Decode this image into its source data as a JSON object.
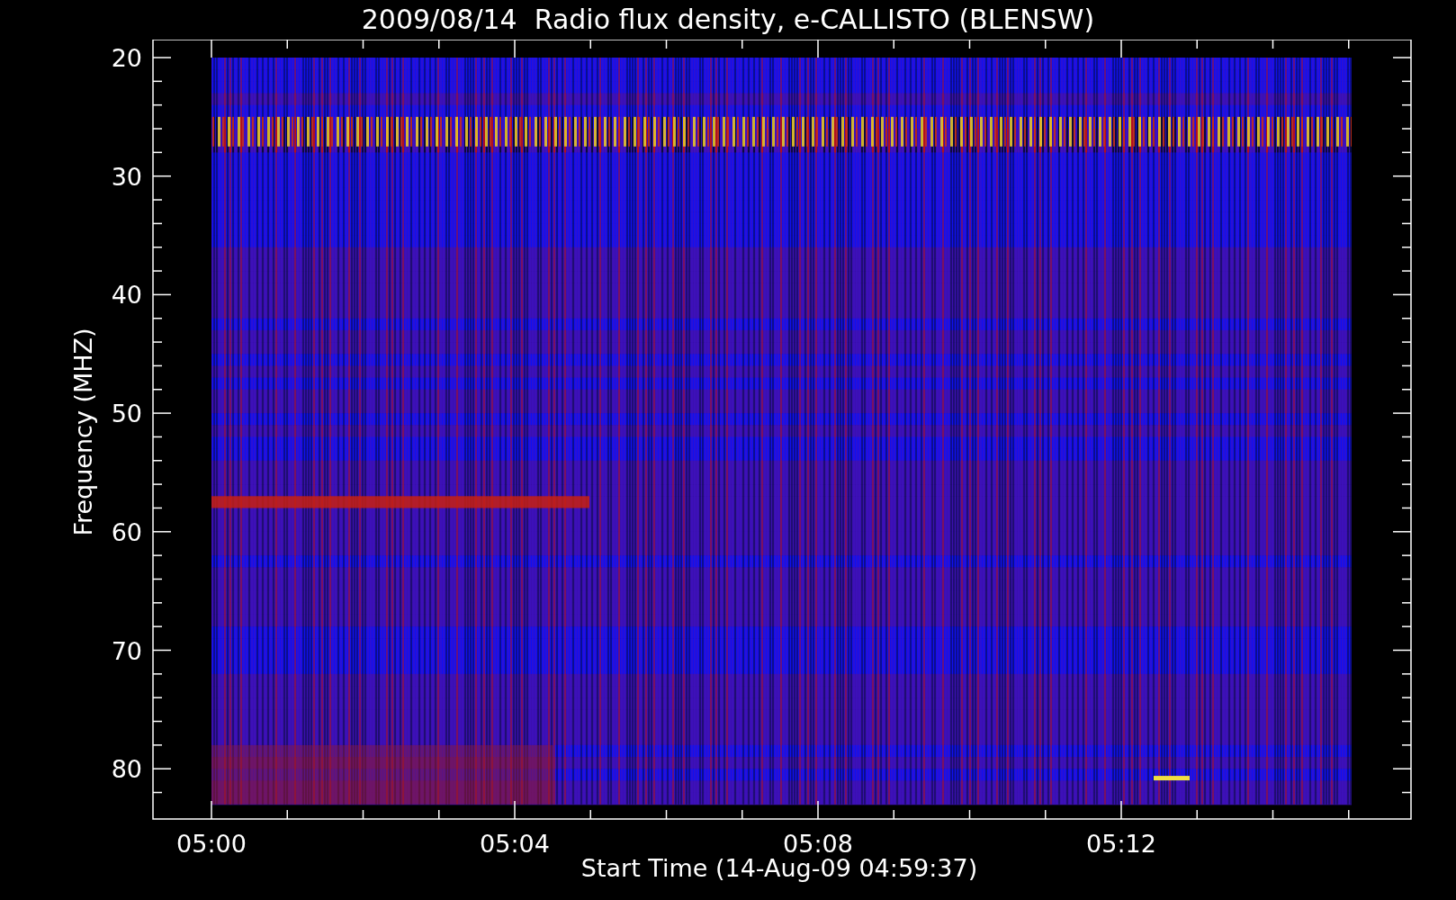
{
  "title": "2009/08/14  Radio flux density, e-CALLISTO (BLENSW)",
  "plot": {
    "ylabel": "Frequency (MHZ)",
    "xlabel": "Start Time (14-Aug-09 04:59:37)",
    "yticks": [
      "20",
      "30",
      "40",
      "50",
      "60",
      "70",
      "80"
    ],
    "xticks": [
      "05:00",
      "05:04",
      "05:08",
      "05:12"
    ]
  }
}
